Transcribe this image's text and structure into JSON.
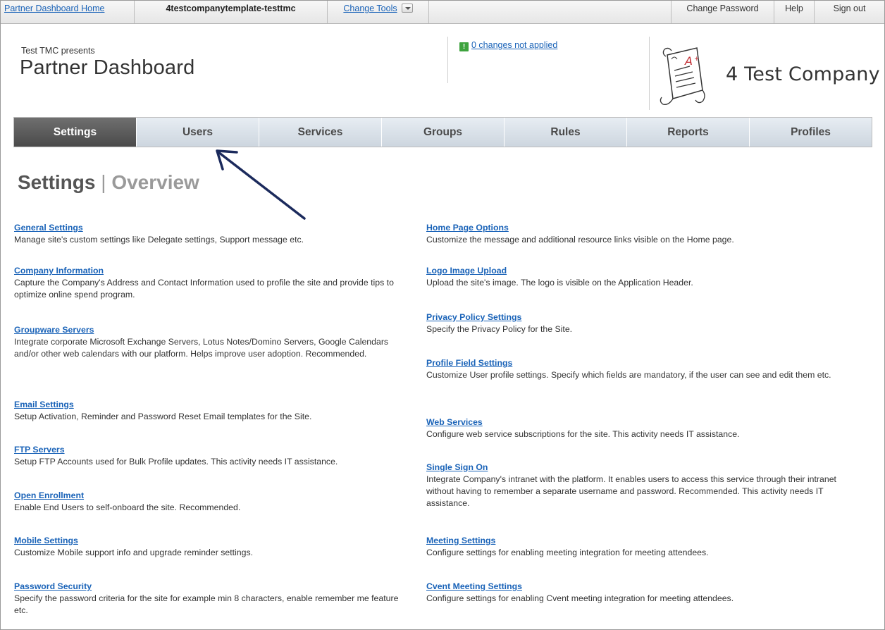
{
  "topbar": {
    "home_link": "Partner Dashboard Home",
    "site_name": "4testcompanytemplate-testtmc",
    "change_tools": "Change Tools",
    "change_password": "Change Password",
    "help": "Help",
    "sign_out": "Sign out"
  },
  "header": {
    "presents": "Test TMC presents",
    "title": "Partner Dashboard",
    "changes_link": "0 changes not applied",
    "company_name": "4 Test Company"
  },
  "nav": {
    "tabs": [
      {
        "label": "Settings",
        "active": true
      },
      {
        "label": "Users",
        "active": false
      },
      {
        "label": "Services",
        "active": false
      },
      {
        "label": "Groups",
        "active": false
      },
      {
        "label": "Rules",
        "active": false
      },
      {
        "label": "Reports",
        "active": false
      },
      {
        "label": "Profiles",
        "active": false
      }
    ]
  },
  "page": {
    "title": "Settings",
    "separator": "|",
    "subtitle": "Overview"
  },
  "settings_left": [
    {
      "title": "General Settings",
      "desc": "Manage site's custom settings like Delegate settings, Support message etc."
    },
    {
      "title": "Company Information",
      "desc": "Capture the Company's Address and Contact Information used to profile the site and provide tips to optimize online spend program."
    },
    {
      "title": "Groupware Servers",
      "desc": "Integrate corporate Microsoft Exchange Servers, Lotus Notes/Domino Servers, Google Calendars and/or other web calendars with our platform. Helps improve user adoption. Recommended."
    },
    {
      "title": "Email Settings",
      "desc": "Setup Activation, Reminder and Password Reset Email templates for the Site."
    },
    {
      "title": "FTP Servers",
      "desc": "Setup FTP Accounts used for Bulk Profile updates. This activity needs IT assistance."
    },
    {
      "title": "Open Enrollment",
      "desc": "Enable End Users to self-onboard the site. Recommended."
    },
    {
      "title": "Mobile Settings",
      "desc": "Customize Mobile support info and upgrade reminder settings."
    },
    {
      "title": "Password Security",
      "desc": "Specify the password criteria for the site for example min 8 characters, enable remember me feature etc."
    }
  ],
  "settings_right": [
    {
      "title": "Home Page Options",
      "desc": "Customize the message and additional resource links visible on the Home page."
    },
    {
      "title": "Logo Image Upload",
      "desc": "Upload the site's image. The logo is visible on the Application Header."
    },
    {
      "title": "Privacy Policy Settings",
      "desc": "Specify the Privacy Policy for the Site."
    },
    {
      "title": "Profile Field Settings",
      "desc": "Customize User profile settings. Specify which fields are mandatory, if the user can see and edit them etc."
    },
    {
      "title": "Web Services",
      "desc": "Configure web service subscriptions for the site. This activity needs IT assistance."
    },
    {
      "title": "Single Sign On",
      "desc": "Integrate Company's intranet with the platform. It enables users to access this service through their intranet without having to remember a separate username and password. Recommended. This activity needs IT assistance."
    },
    {
      "title": "Meeting Settings",
      "desc": "Configure settings for enabling meeting integration for meeting attendees."
    },
    {
      "title": "Cvent Meeting Settings",
      "desc": "Configure settings for enabling Cvent meeting integration for meeting attendees."
    }
  ]
}
